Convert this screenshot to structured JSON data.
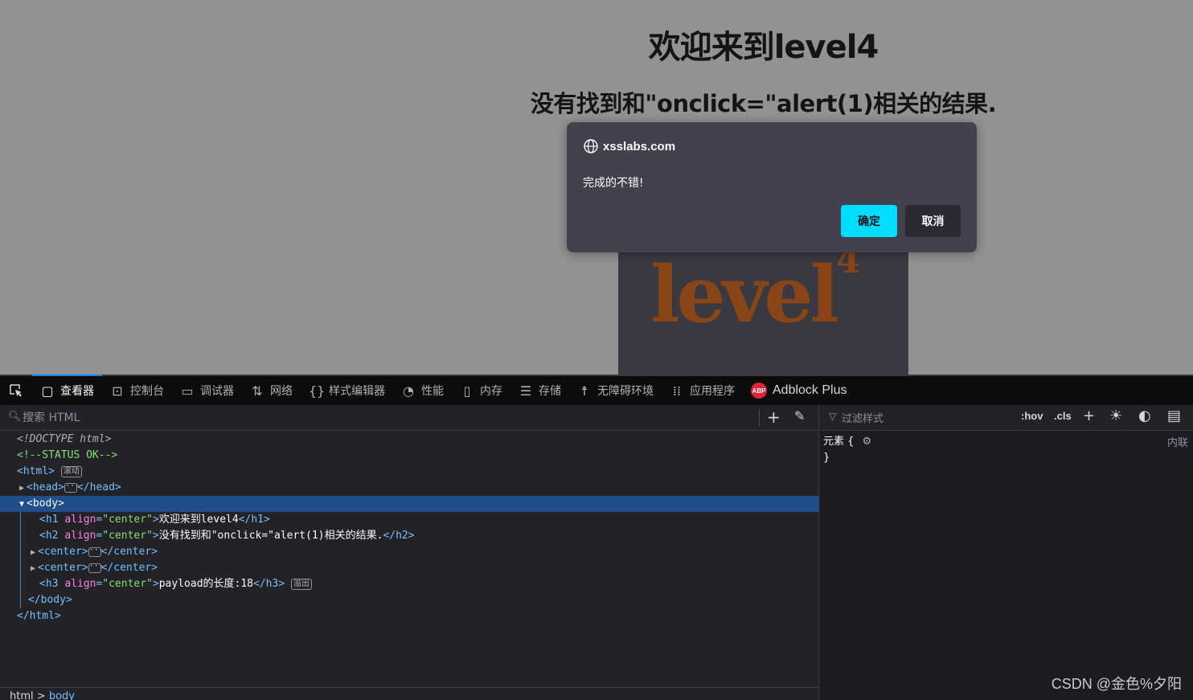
{
  "page": {
    "h1": "欢迎来到level4",
    "h2": "没有找到和\"onclick=\"alert(1)相关的结果.",
    "logo_text": "level",
    "logo_sup": "4"
  },
  "dialog": {
    "host": "xsslabs.com",
    "message": "完成的不错!",
    "ok_label": "确定",
    "cancel_label": "取消"
  },
  "devtools": {
    "tabs": [
      {
        "label": "查看器",
        "icon": "inspector-icon",
        "active": true
      },
      {
        "label": "控制台",
        "icon": "console-icon"
      },
      {
        "label": "调试器",
        "icon": "debugger-icon"
      },
      {
        "label": "网络",
        "icon": "network-icon"
      },
      {
        "label": "样式编辑器",
        "icon": "style-editor-icon"
      },
      {
        "label": "性能",
        "icon": "performance-icon"
      },
      {
        "label": "内存",
        "icon": "memory-icon"
      },
      {
        "label": "存储",
        "icon": "storage-icon"
      },
      {
        "label": "无障碍环境",
        "icon": "accessibility-icon"
      },
      {
        "label": "应用程序",
        "icon": "application-icon"
      },
      {
        "label": "Adblock Plus",
        "icon": "abp-icon",
        "badge": "ABP"
      }
    ],
    "search_placeholder": "搜索 HTML",
    "tree": {
      "doctype": "<!DOCTYPE html>",
      "comment": "<!--STATUS OK-->",
      "html_open": "<html>",
      "html_badge": "滚动",
      "head_open": "<head>",
      "head_close": "</head>",
      "body_open": "<body>",
      "h1_tag_open": "<h1",
      "attr_align": "align",
      "attr_center": "\"center\"",
      "h1_text": "欢迎来到level4",
      "h1_close": "</h1>",
      "h2_tag_open": "<h2",
      "h2_text": "没有找到和\"onclick=\"alert(1)相关的结果.",
      "h2_close": "</h2>",
      "center_open": "<center>",
      "center_close": "</center>",
      "h3_tag_open": "<h3",
      "h3_text": "payload的长度:18",
      "h3_close": "</h3>",
      "h3_badge": "溢出",
      "body_close": "</body>",
      "html_close": "</html>"
    },
    "breadcrumb": {
      "root": "html",
      "sep": ">",
      "current": "body"
    },
    "rules": {
      "filter_placeholder": "过滤样式",
      "hov": ":hov",
      "cls": ".cls",
      "selector": "元素 {",
      "close": "}",
      "source": "内联"
    }
  },
  "watermark": "CSDN @金色%夕阳"
}
